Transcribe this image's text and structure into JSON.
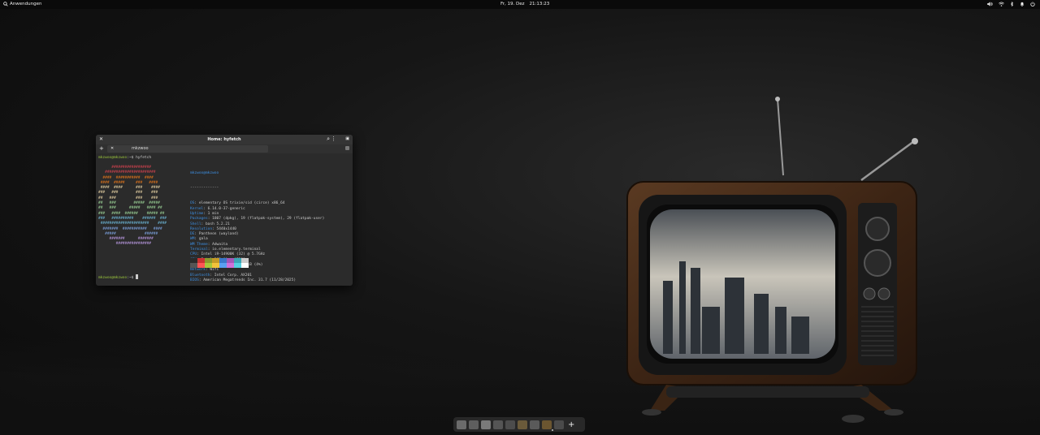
{
  "panel": {
    "apps_label": "Anwendungen",
    "date": "Fr, 19. Dez",
    "time": "21:13:23"
  },
  "terminal": {
    "title": "Home: hyfetch",
    "tab_label": "mkzwoo",
    "prompt_user": "mkzwoo@mkzwoo",
    "prompt_path": ":~$",
    "command": " hyfetch",
    "info_header": "mkzwoo@mkzwoo",
    "info_sep": "-------------",
    "info": [
      {
        "key": "OS",
        "value": ": elementary OS trixie/sid (circe) x86_64"
      },
      {
        "key": "Kernel",
        "value": ": 6.14.0-37-generic"
      },
      {
        "key": "Uptime",
        "value": ": 1 min"
      },
      {
        "key": "Packages",
        "value": ": 1807 (dpkg), 19 (flatpak-system), 29 (flatpak-user)"
      },
      {
        "key": "Shell",
        "value": ": bash 5.2.21"
      },
      {
        "key": "Resolution",
        "value": ": 5440x1440"
      },
      {
        "key": "DE",
        "value": ": Pantheon (wayland)"
      },
      {
        "key": "WM",
        "value": ": gala"
      },
      {
        "key": "WM Theme",
        "value": ": Adwaita"
      },
      {
        "key": "Terminal",
        "value": ": io.elementary.terminal"
      },
      {
        "key": "CPU",
        "value": ": Intel i9-14900K (32) @ 5.7GHz"
      },
      {
        "key": "GPU",
        "value": ": Intel DG2 [Arc A750]"
      },
      {
        "key": "Memory",
        "value": ": 2.25 GiB / 46.73 GiB (4%)"
      },
      {
        "key": "Network",
        "value": ": Wifi"
      },
      {
        "key": "Bluetooth",
        "value": ": Intel Corp. AX201"
      },
      {
        "key": "BIOS",
        "value": ": American Megatrends Inc. 31.7 (11/28/2025)"
      }
    ],
    "logo": [
      {
        "text": "      ##################",
        "color": "#e64553"
      },
      {
        "text": "   #######################",
        "color": "#e64553"
      },
      {
        "text": "  ####  ###########  ####",
        "color": "#fe8019"
      },
      {
        "text": " ####  #####     ###   ####",
        "color": "#fe8019"
      },
      {
        "text": " ####  ####      ###    ####",
        "color": "#f9e2af"
      },
      {
        "text": "###   ###        ###    ###",
        "color": "#f9e2af"
      },
      {
        "text": "##   ###         ###    ###",
        "color": "#f9e2af"
      },
      {
        "text": "##   ###        #####  #####",
        "color": "#a6e3a1"
      },
      {
        "text": "##   ###      #####   #### ##",
        "color": "#a6e3a1"
      },
      {
        "text": "###   ####  ######    ##### ##",
        "color": "#a6e3a1"
      },
      {
        "text": "###   ##########    ######  ###",
        "color": "#74c7ec"
      },
      {
        "text": " ######################    ####",
        "color": "#74c7ec"
      },
      {
        "text": "  #######  ###########   ####",
        "color": "#89b4fa"
      },
      {
        "text": "   #####             ######",
        "color": "#89b4fa"
      },
      {
        "text": "     #######      #######",
        "color": "#cba6f7"
      },
      {
        "text": "        ################",
        "color": "#cba6f7"
      }
    ],
    "palette": [
      "#2b2b2b",
      "#cc3333",
      "#8b9a2e",
      "#c49a27",
      "#3a78c9",
      "#a357b8",
      "#3aa5b5",
      "#cccccc",
      "#555555",
      "#ff5555",
      "#a6c83a",
      "#f2c23a",
      "#5aa0f0",
      "#d070d8",
      "#55d0e0",
      "#ffffff"
    ]
  },
  "icons": {
    "volume": "volume-icon",
    "wifi": "wifi-icon",
    "bluetooth": "bluetooth-icon",
    "notifications": "bell-icon",
    "power": "power-icon"
  }
}
